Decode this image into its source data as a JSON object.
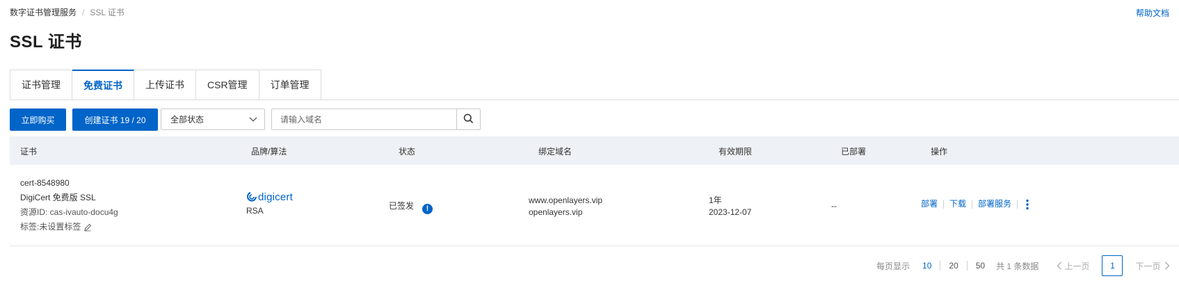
{
  "breadcrumb": {
    "root": "数字证书管理服务",
    "separator": "/",
    "current": "SSL 证书"
  },
  "help_link": "帮助文档",
  "page_title": "SSL 证书",
  "tabs": [
    {
      "label": "证书管理"
    },
    {
      "label": "免费证书",
      "active": true
    },
    {
      "label": "上传证书"
    },
    {
      "label": "CSR管理"
    },
    {
      "label": "订单管理"
    }
  ],
  "toolbar": {
    "buy_label": "立即购买",
    "create_label": "创建证书 19 / 20",
    "status_select": "全部状态",
    "search_placeholder": "请输入域名"
  },
  "table": {
    "headers": [
      "证书",
      "品牌/算法",
      "状态",
      "绑定域名",
      "有效期限",
      "已部署",
      "操作"
    ],
    "rows": [
      {
        "cert_name": "cert-8548980",
        "cert_type": "DigiCert 免费版 SSL",
        "resource_id": "资源ID: cas-ivauto-docu4g",
        "tags": "标签:未设置标签",
        "brand_logo": "digicert",
        "algorithm": "RSA",
        "status": "已签发",
        "domains": [
          "www.openlayers.vip",
          "openlayers.vip"
        ],
        "validity_duration": "1年",
        "validity_date": "2023-12-07",
        "deployed": "--",
        "actions": [
          "部署",
          "下载",
          "部署服务"
        ]
      }
    ]
  },
  "pagination": {
    "per_page_label": "每页显示",
    "sizes": [
      "10",
      "20",
      "50"
    ],
    "selected_size": "10",
    "total": "共 1 条数据",
    "prev": "上一页",
    "next": "下一页",
    "current_page": "1"
  },
  "colors": {
    "primary": "#0064c8",
    "header_bg": "#eef1f6"
  }
}
